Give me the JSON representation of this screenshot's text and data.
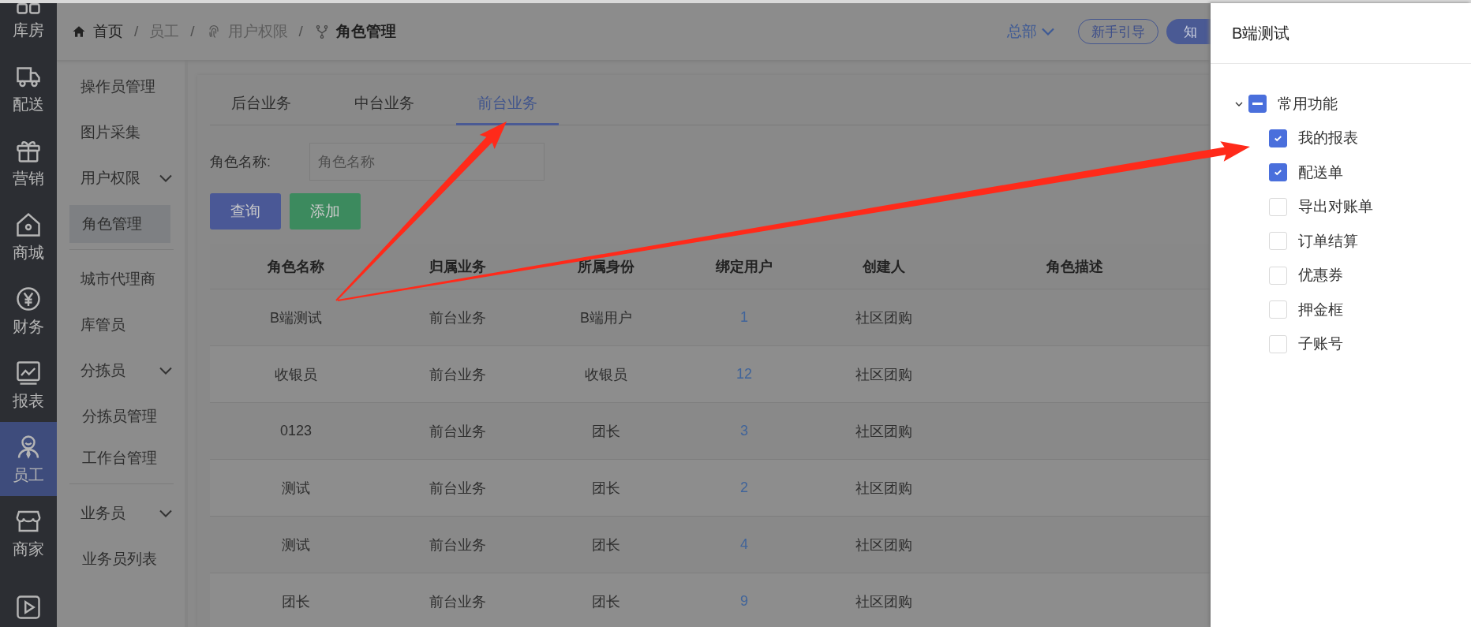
{
  "rail": {
    "items": [
      {
        "label": "库房",
        "selected": false
      },
      {
        "label": "配送",
        "selected": false
      },
      {
        "label": "营销",
        "selected": false
      },
      {
        "label": "商城",
        "selected": false
      },
      {
        "label": "财务",
        "selected": false
      },
      {
        "label": "报表",
        "selected": false
      },
      {
        "label": "员工",
        "selected": true
      },
      {
        "label": "商家",
        "selected": false
      },
      {
        "selected": false
      }
    ]
  },
  "breadcrumb": [
    {
      "label": "首页",
      "current": false
    },
    {
      "separator": "/",
      "label": "员工",
      "current": false
    },
    {
      "separator": "/",
      "label": "用户权限",
      "current": false
    },
    {
      "separator": "/",
      "label": "角色管理",
      "current": true
    }
  ],
  "header": {
    "org_switch": "总部",
    "org_switch_expanded": false,
    "guide_button": "新手引导",
    "knowledge_button": "知"
  },
  "sidebar": {
    "items": [
      {
        "label": "操作员管理",
        "selected": false
      },
      {
        "label": "图片采集",
        "selected": false
      },
      {
        "label": "用户权限",
        "selected": false,
        "expanded": true,
        "children": [
          {
            "label": "角色管理",
            "selected": true
          }
        ]
      },
      {
        "label": "城市代理商",
        "selected": false
      },
      {
        "label": "库管员",
        "selected": false
      },
      {
        "label": "分拣员",
        "selected": false,
        "expanded": true,
        "children": [
          {
            "label": "分拣员管理",
            "selected": false
          },
          {
            "label": "工作台管理",
            "selected": false
          }
        ]
      },
      {
        "label": "业务员",
        "selected": false,
        "expanded": true,
        "children": [
          {
            "label": "业务员列表",
            "selected": false
          }
        ]
      }
    ]
  },
  "tabs": [
    {
      "label": "后台业务",
      "selected": false
    },
    {
      "label": "中台业务",
      "selected": false
    },
    {
      "label": "前台业务",
      "selected": true
    }
  ],
  "filter": {
    "label": "角色名称:",
    "placeholder": "角色名称"
  },
  "buttons": [
    {
      "label": "查询",
      "kind": "primary"
    },
    {
      "label": "添加",
      "kind": "success"
    }
  ],
  "table": {
    "columns": [
      {
        "label": "角色名称",
        "kind": "text"
      },
      {
        "label": "归属业务",
        "kind": "text"
      },
      {
        "label": "所属身份",
        "kind": "text"
      },
      {
        "label": "绑定用户",
        "kind": "link"
      },
      {
        "label": "创建人",
        "kind": "text"
      },
      {
        "label": "角色描述"
      }
    ],
    "rows": [
      [
        "B端测试",
        "前台业务",
        "B端用户",
        "1",
        "社区团购"
      ],
      [
        "收银员",
        "前台业务",
        "收银员",
        "12",
        "社区团购"
      ],
      [
        "0123",
        "前台业务",
        "团长",
        "3",
        "社区团购"
      ],
      [
        "测试",
        "前台业务",
        "团长",
        "2",
        "社区团购"
      ],
      [
        "测试",
        "前台业务",
        "团长",
        "4",
        "社区团购"
      ],
      [
        "团长",
        "前台业务",
        "团长",
        "9",
        "社区团购"
      ]
    ]
  },
  "drawer": {
    "title": "B端测试",
    "tree": [
      {
        "label": "常用功能",
        "expanded": true,
        "indeterminate": true,
        "children": [
          {
            "label": "我的报表",
            "checked": true
          },
          {
            "label": "配送单",
            "checked": true
          },
          {
            "label": "导出对账单",
            "checked": false
          },
          {
            "label": "订单结算",
            "checked": false
          },
          {
            "label": "优惠券",
            "checked": false
          },
          {
            "label": "押金框",
            "checked": false
          },
          {
            "label": "子账号",
            "checked": false
          }
        ]
      }
    ]
  }
}
